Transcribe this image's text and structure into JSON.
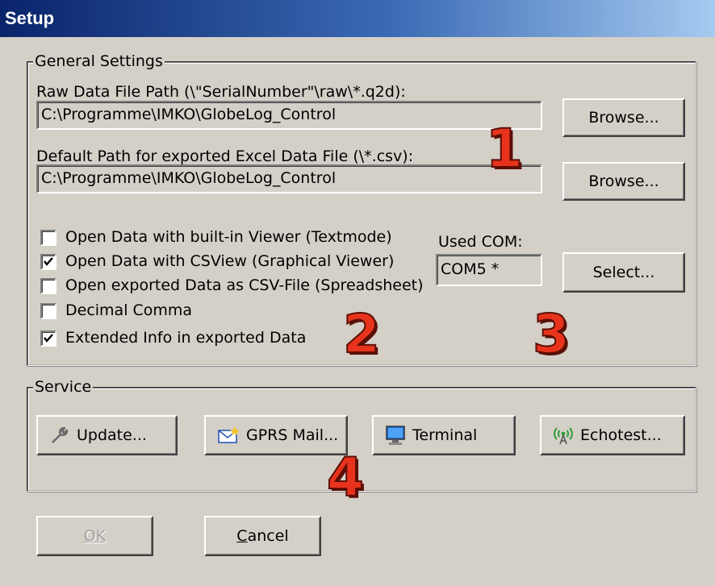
{
  "window": {
    "title": "Setup"
  },
  "general": {
    "legend": "General Settings",
    "raw_path_label": "Raw Data File Path (\\\"SerialNumber\"\\raw\\*.q2d):",
    "raw_path_value": "C:\\Programme\\IMKO\\GlobeLog_Control",
    "excel_path_label": "Default Path for exported Excel Data File (\\*.csv):",
    "excel_path_value": "C:\\Programme\\IMKO\\GlobeLog_Control",
    "browse_label": "Browse...",
    "checkboxes": [
      {
        "label": "Open Data with built-in Viewer (Textmode)",
        "checked": false
      },
      {
        "label": "Open Data with CSView (Graphical Viewer)",
        "checked": true
      },
      {
        "label": "Open exported Data as CSV-File (Spreadsheet)",
        "checked": false
      },
      {
        "label": "Decimal Comma",
        "checked": false
      },
      {
        "label": "Extended Info in exported Data",
        "checked": true
      }
    ],
    "used_com_label": "Used COM:",
    "used_com_value": "COM5 *",
    "select_label": "Select..."
  },
  "service": {
    "legend": "Service",
    "update_label": "Update...",
    "gprs_label": "GPRS Mail...",
    "terminal_label": "Terminal",
    "echotest_label": "Echotest..."
  },
  "footer": {
    "ok_label": "OK",
    "cancel_label": "Cancel"
  },
  "annotations": [
    "1",
    "2",
    "3",
    "4"
  ],
  "colors": {
    "annotation": "#e8331c",
    "titlebar_start": "#0a246a",
    "titlebar_end": "#a6caf0"
  }
}
